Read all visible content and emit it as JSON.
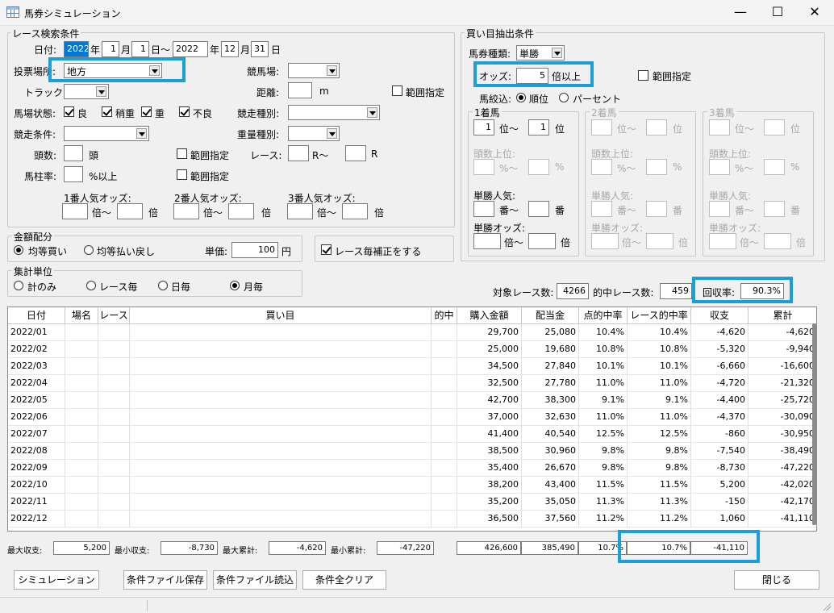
{
  "window": {
    "title": "馬券シミュレーション",
    "minimize": "—",
    "maximize": "☐",
    "close": "✕"
  },
  "race": {
    "group": "レース検索条件",
    "date_label": "日付:",
    "from_year": "2022",
    "year_unit": "年",
    "from_month": "1",
    "month_unit": "月",
    "from_day": "1",
    "day_unit_tilde": "日〜",
    "to_year": "2022",
    "to_month": "12",
    "to_day": "31",
    "day_unit": "日",
    "venue_label": "投票場所:",
    "venue_value": "地方",
    "track_label": "競馬場:",
    "track2_label": "トラック:",
    "distance_label": "距離:",
    "distance_unit": "m",
    "range_label": "範囲指定",
    "condition_label": "馬場状態:",
    "cond_good": "良",
    "cond_slightly": "稍重",
    "cond_heavy": "重",
    "cond_bad": "不良",
    "race_type_label": "競走種別:",
    "race_cond_label": "競走条件:",
    "weight_label": "重量種別:",
    "heads_label": "頭数:",
    "heads_unit": "頭",
    "heads_range": "範囲指定",
    "race_label": "レース:",
    "race_tilde": "R〜",
    "race_r": "R",
    "pillar_label": "馬柱率:",
    "pillar_unit": "%以上",
    "pillar_range": "範囲指定",
    "fav1_label": "1番人気オッズ:",
    "fav2_label": "2番人気オッズ:",
    "fav3_label": "3番人気オッズ:",
    "bai_tilde": "倍〜",
    "bai": "倍"
  },
  "buy": {
    "group": "買い目抽出条件",
    "ticket_label": "馬券種類:",
    "ticket_value": "単勝",
    "odds_label": "オッズ:",
    "odds_value": "5",
    "odds_unit": "倍以上",
    "range_label": "範囲指定",
    "narrow_label": "馬絞込:",
    "narrow_rank": "順位",
    "narrow_percent": "パーセント",
    "p1": {
      "title": "1着馬",
      "rank_from": "1",
      "rank_to": "1"
    },
    "p2": {
      "title": "2着馬"
    },
    "p3": {
      "title": "3着馬"
    },
    "rank_unit_tilde": "位〜",
    "rank_unit": "位",
    "heads_top": "頭数上位:",
    "pct_tilde": "%〜",
    "pct": "%",
    "win_pop": "単勝人気:",
    "ban_tilde": "番〜",
    "ban": "番",
    "win_odds": "単勝オッズ:",
    "bai_tilde": "倍〜",
    "bai": "倍"
  },
  "amount": {
    "group": "金額配分",
    "equal_buy": "均等買い",
    "equal_pay": "均等払い戻し",
    "unit_label": "単価:",
    "unit_value": "100",
    "yen": "円",
    "correction": "レース毎補正をする"
  },
  "tally": {
    "group": "集計単位",
    "total": "計のみ",
    "per_race": "レース毎",
    "daily": "日毎",
    "monthly": "月毎"
  },
  "stats": {
    "races_label": "対象レース数:",
    "races_value": "4266",
    "hit_label": "的中レース数:",
    "hit_value": "459",
    "recovery_label": "回収率:",
    "recovery_value": "90.3%"
  },
  "table": {
    "headers": [
      "日付",
      "場名",
      "レース",
      "買い目",
      "的中",
      "購入金額",
      "配当金",
      "点的中率",
      "レース的中率",
      "収支",
      "累計"
    ],
    "rows": [
      [
        "2022/01",
        "29,700",
        "25,080",
        "10.4%",
        "10.4%",
        "-4,620",
        "-4,620"
      ],
      [
        "2022/02",
        "25,000",
        "19,680",
        "10.8%",
        "10.8%",
        "-5,320",
        "-9,940"
      ],
      [
        "2022/03",
        "34,500",
        "27,840",
        "10.1%",
        "10.1%",
        "-6,660",
        "-16,600"
      ],
      [
        "2022/04",
        "32,500",
        "27,780",
        "11.0%",
        "11.0%",
        "-4,720",
        "-21,320"
      ],
      [
        "2022/05",
        "42,700",
        "38,300",
        "9.1%",
        "9.1%",
        "-4,400",
        "-25,720"
      ],
      [
        "2022/06",
        "37,000",
        "32,630",
        "11.0%",
        "11.0%",
        "-4,370",
        "-30,090"
      ],
      [
        "2022/07",
        "41,400",
        "40,540",
        "12.5%",
        "12.5%",
        "-860",
        "-30,950"
      ],
      [
        "2022/08",
        "38,500",
        "30,960",
        "9.8%",
        "9.8%",
        "-7,540",
        "-38,490"
      ],
      [
        "2022/09",
        "35,400",
        "26,670",
        "9.8%",
        "9.8%",
        "-8,730",
        "-47,220"
      ],
      [
        "2022/10",
        "38,200",
        "43,400",
        "11.5%",
        "11.5%",
        "5,200",
        "-42,020"
      ],
      [
        "2022/11",
        "35,200",
        "35,050",
        "11.3%",
        "11.3%",
        "-150",
        "-42,170"
      ],
      [
        "2022/12",
        "36,500",
        "37,560",
        "11.2%",
        "11.2%",
        "1,060",
        "-41,110"
      ]
    ]
  },
  "summary": {
    "max_income_label": "最大収支:",
    "max_income": "5,200",
    "min_income_label": "最小収支:",
    "min_income": "-8,730",
    "max_cum_label": "最大累計:",
    "max_cum": "-4,620",
    "min_cum_label": "最小累計:",
    "min_cum": "-47,220",
    "total_purchase": "426,600",
    "total_payout": "385,490",
    "point_hit": "10.7%",
    "race_hit": "10.7%",
    "balance": "-41,110"
  },
  "buttons": {
    "simulate": "シミュレーション",
    "save": "条件ファイル保存",
    "load": "条件ファイル読込",
    "clear": "条件全クリア",
    "close": "閉じる"
  },
  "colors": {
    "highlight": "#1a9fd8",
    "selection": "#0078d7"
  }
}
